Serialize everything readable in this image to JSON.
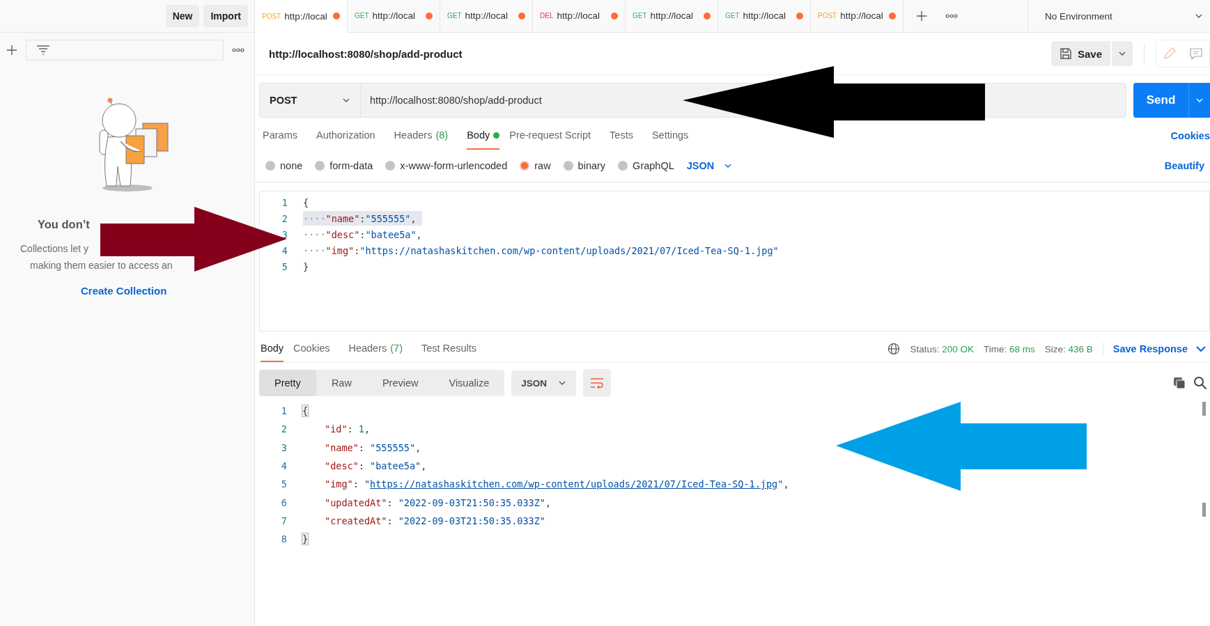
{
  "sidebar": {
    "buttons": [
      "New",
      "Import"
    ],
    "empty_state": {
      "title": "You don’t",
      "lines": [
        "Collections let y",
        "making them easier to access an"
      ],
      "action": "Create Collection"
    }
  },
  "request_tabs": [
    {
      "method": "POST",
      "url": "http://local",
      "color": "#f5a623",
      "selected": true,
      "unsaved": true
    },
    {
      "method": "GET",
      "url": "http://local",
      "color": "#3aae5e",
      "selected": false,
      "unsaved": true
    },
    {
      "method": "GET",
      "url": "http://local",
      "color": "#3aae5e",
      "selected": false,
      "unsaved": true
    },
    {
      "method": "DEL",
      "url": "http://local",
      "color": "#e0364a",
      "selected": false,
      "unsaved": true
    },
    {
      "method": "GET",
      "url": "http://local",
      "color": "#3aae5e",
      "selected": false,
      "unsaved": true
    },
    {
      "method": "GET",
      "url": "http://local",
      "color": "#3aae5e",
      "selected": false,
      "unsaved": true
    },
    {
      "method": "POST",
      "url": "http://local",
      "color": "#f5a623",
      "selected": false,
      "unsaved": true
    }
  ],
  "environment": {
    "label": "No Environment"
  },
  "request": {
    "title": "http://localhost:8080/shop/add-product",
    "save": "Save",
    "method": "POST",
    "url": "http://localhost:8080/shop/add-product",
    "send": "Send",
    "tabs": [
      {
        "label": "Params",
        "selected": false
      },
      {
        "label": "Authorization",
        "selected": false
      },
      {
        "label": "Headers",
        "count": "(8)",
        "selected": false
      },
      {
        "label": "Body",
        "selected": true,
        "dot": true
      },
      {
        "label": "Pre-request Script",
        "selected": false
      },
      {
        "label": "Tests",
        "selected": false
      },
      {
        "label": "Settings",
        "selected": false
      }
    ],
    "cookies": "Cookies",
    "body_types": [
      {
        "label": "none",
        "selected": false
      },
      {
        "label": "form-data",
        "selected": false
      },
      {
        "label": "x-www-form-urlencoded",
        "selected": false
      },
      {
        "label": "raw",
        "selected": true
      },
      {
        "label": "binary",
        "selected": false
      },
      {
        "label": "GraphQL",
        "selected": false
      }
    ],
    "format": "JSON",
    "beautify": "Beautify",
    "editor": [
      {
        "number": "1",
        "highlighted": false,
        "tokens": [
          {
            "kind": "punct",
            "text": "{"
          }
        ]
      },
      {
        "number": "2",
        "highlighted": true,
        "tokens": [
          {
            "kind": "space",
            "text": "····"
          },
          {
            "kind": "key",
            "text": "\"name\""
          },
          {
            "kind": "punct",
            "text": ":"
          },
          {
            "kind": "string",
            "text": "\"555555\""
          },
          {
            "kind": "punct",
            "text": ","
          }
        ]
      },
      {
        "number": "3",
        "highlighted": false,
        "tokens": [
          {
            "kind": "space",
            "text": "····"
          },
          {
            "kind": "key",
            "text": "\"desc\""
          },
          {
            "kind": "punct",
            "text": ":"
          },
          {
            "kind": "string",
            "text": "\"batee5a\""
          },
          {
            "kind": "punct",
            "text": ","
          }
        ]
      },
      {
        "number": "4",
        "highlighted": false,
        "tokens": [
          {
            "kind": "space",
            "text": "····"
          },
          {
            "kind": "key",
            "text": "\"img\""
          },
          {
            "kind": "punct",
            "text": ":"
          },
          {
            "kind": "string",
            "text": "\"https://natashaskitchen.com/wp-content/uploads/2021/07/Iced-Tea-SQ-1.jpg\""
          }
        ]
      },
      {
        "number": "5",
        "highlighted": false,
        "tokens": [
          {
            "kind": "punct",
            "text": "}"
          }
        ]
      }
    ]
  },
  "response": {
    "tabs": [
      {
        "label": "Body",
        "selected": true
      },
      {
        "label": "Cookies",
        "selected": false
      },
      {
        "label": "Headers",
        "count": "(7)",
        "selected": false
      },
      {
        "label": "Test Results",
        "selected": false
      }
    ],
    "status_label": "Status:",
    "status": "200 OK",
    "time_label": "Time:",
    "time": "68 ms",
    "size_label": "Size:",
    "size": "436 B",
    "save": "Save Response",
    "views": [
      {
        "label": "Pretty",
        "selected": true
      },
      {
        "label": "Raw",
        "selected": false
      },
      {
        "label": "Preview",
        "selected": false
      },
      {
        "label": "Visualize",
        "selected": false
      }
    ],
    "format": "JSON",
    "lines": [
      {
        "number": "1",
        "indented": false,
        "tokens": [
          {
            "kind": "bracket",
            "text": "{"
          }
        ]
      },
      {
        "number": "2",
        "indented": true,
        "tokens": [
          {
            "kind": "key",
            "text": "\"id\""
          },
          {
            "kind": "punct",
            "text": ": "
          },
          {
            "kind": "number",
            "text": "1"
          },
          {
            "kind": "punct",
            "text": ","
          }
        ]
      },
      {
        "number": "3",
        "indented": true,
        "tokens": [
          {
            "kind": "key",
            "text": "\"name\""
          },
          {
            "kind": "punct",
            "text": ": "
          },
          {
            "kind": "string",
            "text": "\"555555\""
          },
          {
            "kind": "punct",
            "text": ","
          }
        ]
      },
      {
        "number": "4",
        "indented": true,
        "tokens": [
          {
            "kind": "key",
            "text": "\"desc\""
          },
          {
            "kind": "punct",
            "text": ": "
          },
          {
            "kind": "string",
            "text": "\"batee5a\""
          },
          {
            "kind": "punct",
            "text": ","
          }
        ]
      },
      {
        "number": "5",
        "indented": true,
        "tokens": [
          {
            "kind": "key",
            "text": "\"img\""
          },
          {
            "kind": "punct",
            "text": ": "
          },
          {
            "kind": "string",
            "text": "\""
          },
          {
            "kind": "link",
            "text": "https://natashaskitchen.com/wp-content/uploads/2021/07/Iced-Tea-SQ-1.jpg"
          },
          {
            "kind": "string",
            "text": "\""
          },
          {
            "kind": "punct",
            "text": ","
          }
        ]
      },
      {
        "number": "6",
        "indented": true,
        "tokens": [
          {
            "kind": "key",
            "text": "\"updatedAt\""
          },
          {
            "kind": "punct",
            "text": ": "
          },
          {
            "kind": "string",
            "text": "\"2022-09-03T21:50:35.033Z\""
          },
          {
            "kind": "punct",
            "text": ","
          }
        ]
      },
      {
        "number": "7",
        "indented": true,
        "tokens": [
          {
            "kind": "key",
            "text": "\"createdAt\""
          },
          {
            "kind": "punct",
            "text": ": "
          },
          {
            "kind": "string",
            "text": "\"2022-09-03T21:50:35.033Z\""
          }
        ]
      },
      {
        "number": "8",
        "indented": false,
        "tokens": [
          {
            "kind": "bracket",
            "text": "}"
          }
        ]
      }
    ]
  },
  "annotations": [
    {
      "color": "#000000"
    },
    {
      "color": "#85001a"
    },
    {
      "color": "#00a0e6"
    }
  ]
}
